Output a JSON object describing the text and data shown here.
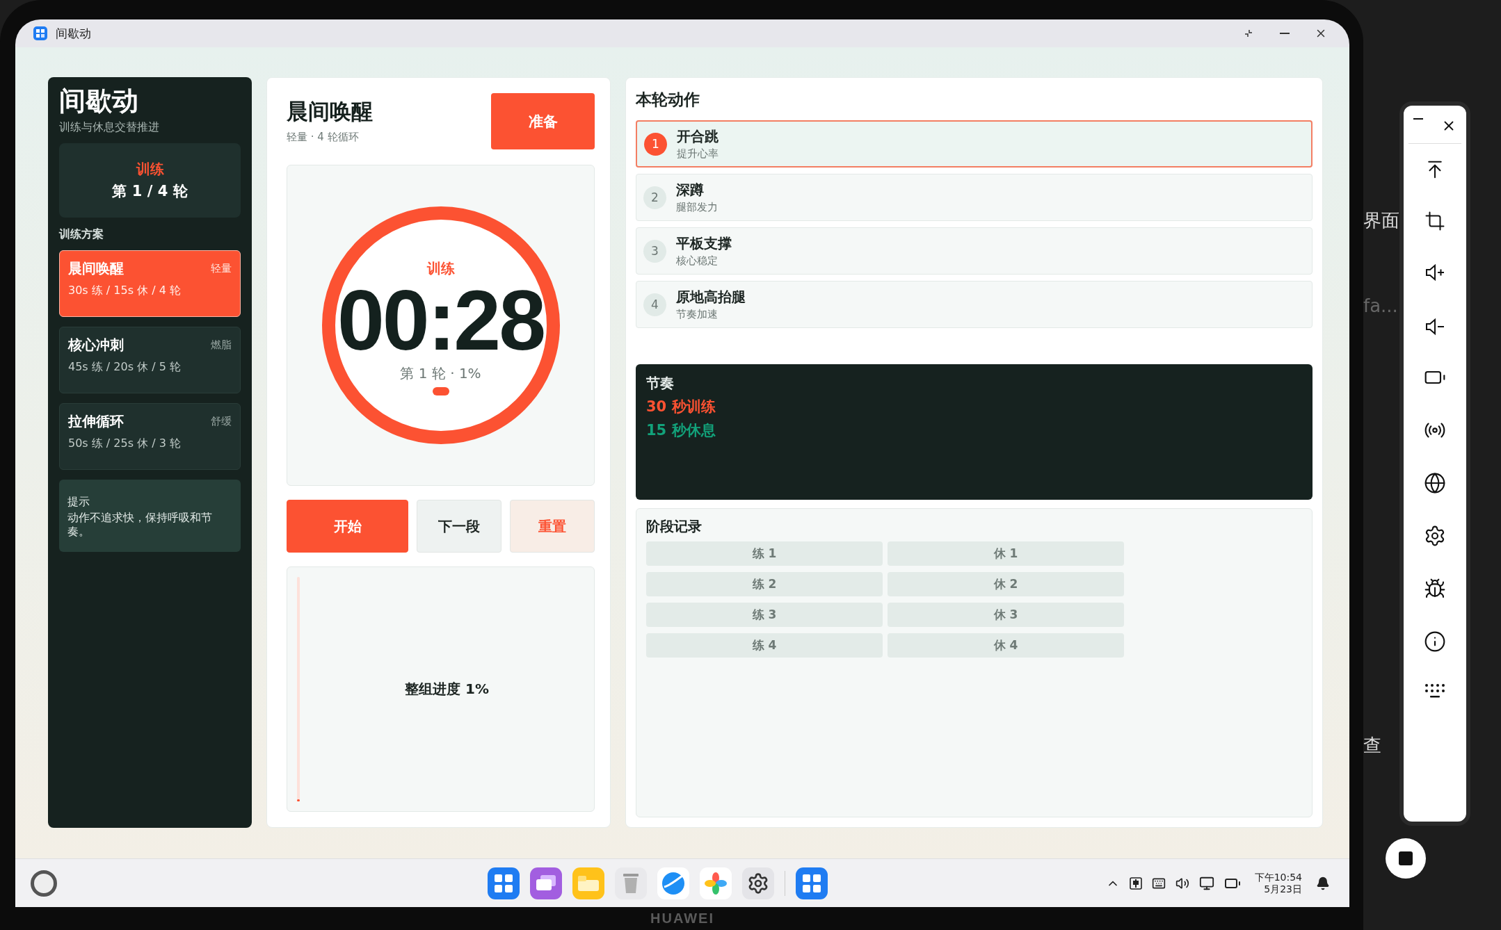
{
  "window": {
    "title": "间歇动"
  },
  "sidebar": {
    "app_name": "间歇动",
    "tagline": "训练与休息交替推进",
    "status": {
      "phase": "训练",
      "round": "第 1 / 4 轮"
    },
    "plans_label": "训练方案",
    "plans": [
      {
        "name": "晨间唤醒",
        "tag": "轻量",
        "detail": "30s 练 / 15s 休 / 4 轮",
        "selected": true
      },
      {
        "name": "核心冲刺",
        "tag": "燃脂",
        "detail": "45s 练 / 20s 休 / 5 轮",
        "selected": false
      },
      {
        "name": "拉伸循环",
        "tag": "舒缓",
        "detail": "50s 练 / 25s 休 / 3 轮",
        "selected": false
      }
    ],
    "tip": {
      "label": "提示",
      "text": "动作不追求快，保持呼吸和节奏。"
    }
  },
  "session": {
    "title": "晨间唤醒",
    "subtitle": "轻量 · 4 轮循环",
    "ready_button": "准备",
    "timer": {
      "phase": "训练",
      "time": "00:28",
      "caption": "第 1 轮 · 1%"
    },
    "controls": [
      {
        "label": "开始",
        "kind": "primary"
      },
      {
        "label": "下一段",
        "kind": "neutral"
      },
      {
        "label": "重置",
        "kind": "danger"
      }
    ],
    "overall": {
      "label": "整组进度 1%",
      "level": 0.01
    }
  },
  "moves": {
    "title": "本轮动作",
    "items": [
      {
        "number": "1",
        "name": "开合跳",
        "note": "提升心率",
        "selected": true
      },
      {
        "number": "2",
        "name": "深蹲",
        "note": "腿部发力",
        "selected": false
      },
      {
        "number": "3",
        "name": "平板支撑",
        "note": "核心稳定",
        "selected": false
      },
      {
        "number": "4",
        "name": "原地高抬腿",
        "note": "节奏加速",
        "selected": false
      }
    ]
  },
  "rhythm": {
    "title": "节奏",
    "work": "30 秒训练",
    "rest": "15 秒休息"
  },
  "stages": {
    "title": "阶段记录",
    "items": [
      "练 1",
      "休 1",
      "练 2",
      "休 2",
      "练 3",
      "休 3",
      "练 4",
      "休 4"
    ]
  },
  "taskbar": {
    "time": "下午10:54",
    "date": "5月23日"
  },
  "device": {
    "brand": "HUAWEI"
  },
  "background": {
    "fragments": [
      "界面",
      "fa...",
      "查"
    ]
  }
}
